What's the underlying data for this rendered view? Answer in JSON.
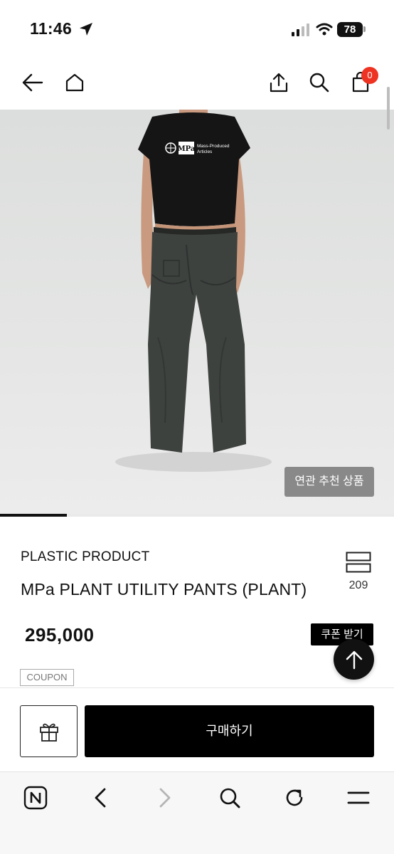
{
  "status_bar": {
    "time": "11:46",
    "battery": "78",
    "icons": [
      "location-arrow-icon",
      "cellular-signal-icon",
      "wifi-icon",
      "battery-icon"
    ]
  },
  "top_nav": {
    "icons": [
      "back-arrow-icon",
      "home-icon",
      "share-icon",
      "search-icon",
      "cart-icon"
    ],
    "cart_count": "0",
    "badge_color": "#e83a2f"
  },
  "hero": {
    "print_logo": "MPa",
    "print_text_line1": "Mass-Produced",
    "print_text_line2": "Articles",
    "related_button_label": "연관 추천 상품",
    "slide_progress": 0.17
  },
  "product": {
    "brand": "PLASTIC PRODUCT",
    "name": "MPa PLANT UTILITY PANTS (PLANT)",
    "count": "209",
    "price": "295,000",
    "coupon_button_label": "쿠폰 받기",
    "coupon_tag": "COUPON"
  },
  "purchase_bar": {
    "buy_label": "구매하기",
    "gift_icon": "gift-icon"
  },
  "browser_toolbar": {
    "icons": [
      "naver-logo-icon",
      "back-chevron-icon",
      "forward-chevron-icon",
      "search-icon",
      "reload-icon",
      "menu-icon"
    ]
  },
  "colors": {
    "accent": "#000000",
    "badge": "#e83a2f",
    "overlay_button": "#787878"
  }
}
